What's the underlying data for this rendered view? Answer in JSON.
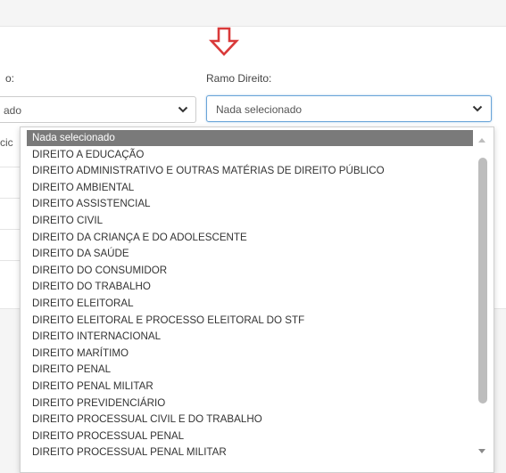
{
  "form": {
    "left_label": "o:",
    "left_value": "ado",
    "right_label": "Ramo Direito:",
    "right_value": "Nada selecionado",
    "cut_text": "cic"
  },
  "dropdown": {
    "options": [
      "Nada selecionado",
      "DIREITO A EDUCAÇÃO",
      "DIREITO ADMINISTRATIVO E OUTRAS MATÉRIAS DE DIREITO PÚBLICO",
      "DIREITO AMBIENTAL",
      "DIREITO ASSISTENCIAL",
      "DIREITO CIVIL",
      "DIREITO DA CRIANÇA E DO ADOLESCENTE",
      "DIREITO DA SAÚDE",
      "DIREITO DO CONSUMIDOR",
      "DIREITO DO TRABALHO",
      "DIREITO ELEITORAL",
      "DIREITO ELEITORAL E PROCESSO ELEITORAL DO STF",
      "DIREITO INTERNACIONAL",
      "DIREITO MARÍTIMO",
      "DIREITO PENAL",
      "DIREITO PENAL MILITAR",
      "DIREITO PREVIDENCIÁRIO",
      "DIREITO PROCESSUAL CIVIL E DO TRABALHO",
      "DIREITO PROCESSUAL PENAL",
      "DIREITO PROCESSUAL PENAL MILITAR"
    ],
    "selected_index": 0
  },
  "colors": {
    "arrow": "#d93a3a",
    "focus_border": "#6aa5d8",
    "selected_bg": "#7a7a7a"
  },
  "icons": {
    "annotation": "arrow-down-outline-icon",
    "select": "chevron-down-icon",
    "scroll_up": "triangle-up-icon",
    "scroll_down": "triangle-down-icon"
  }
}
